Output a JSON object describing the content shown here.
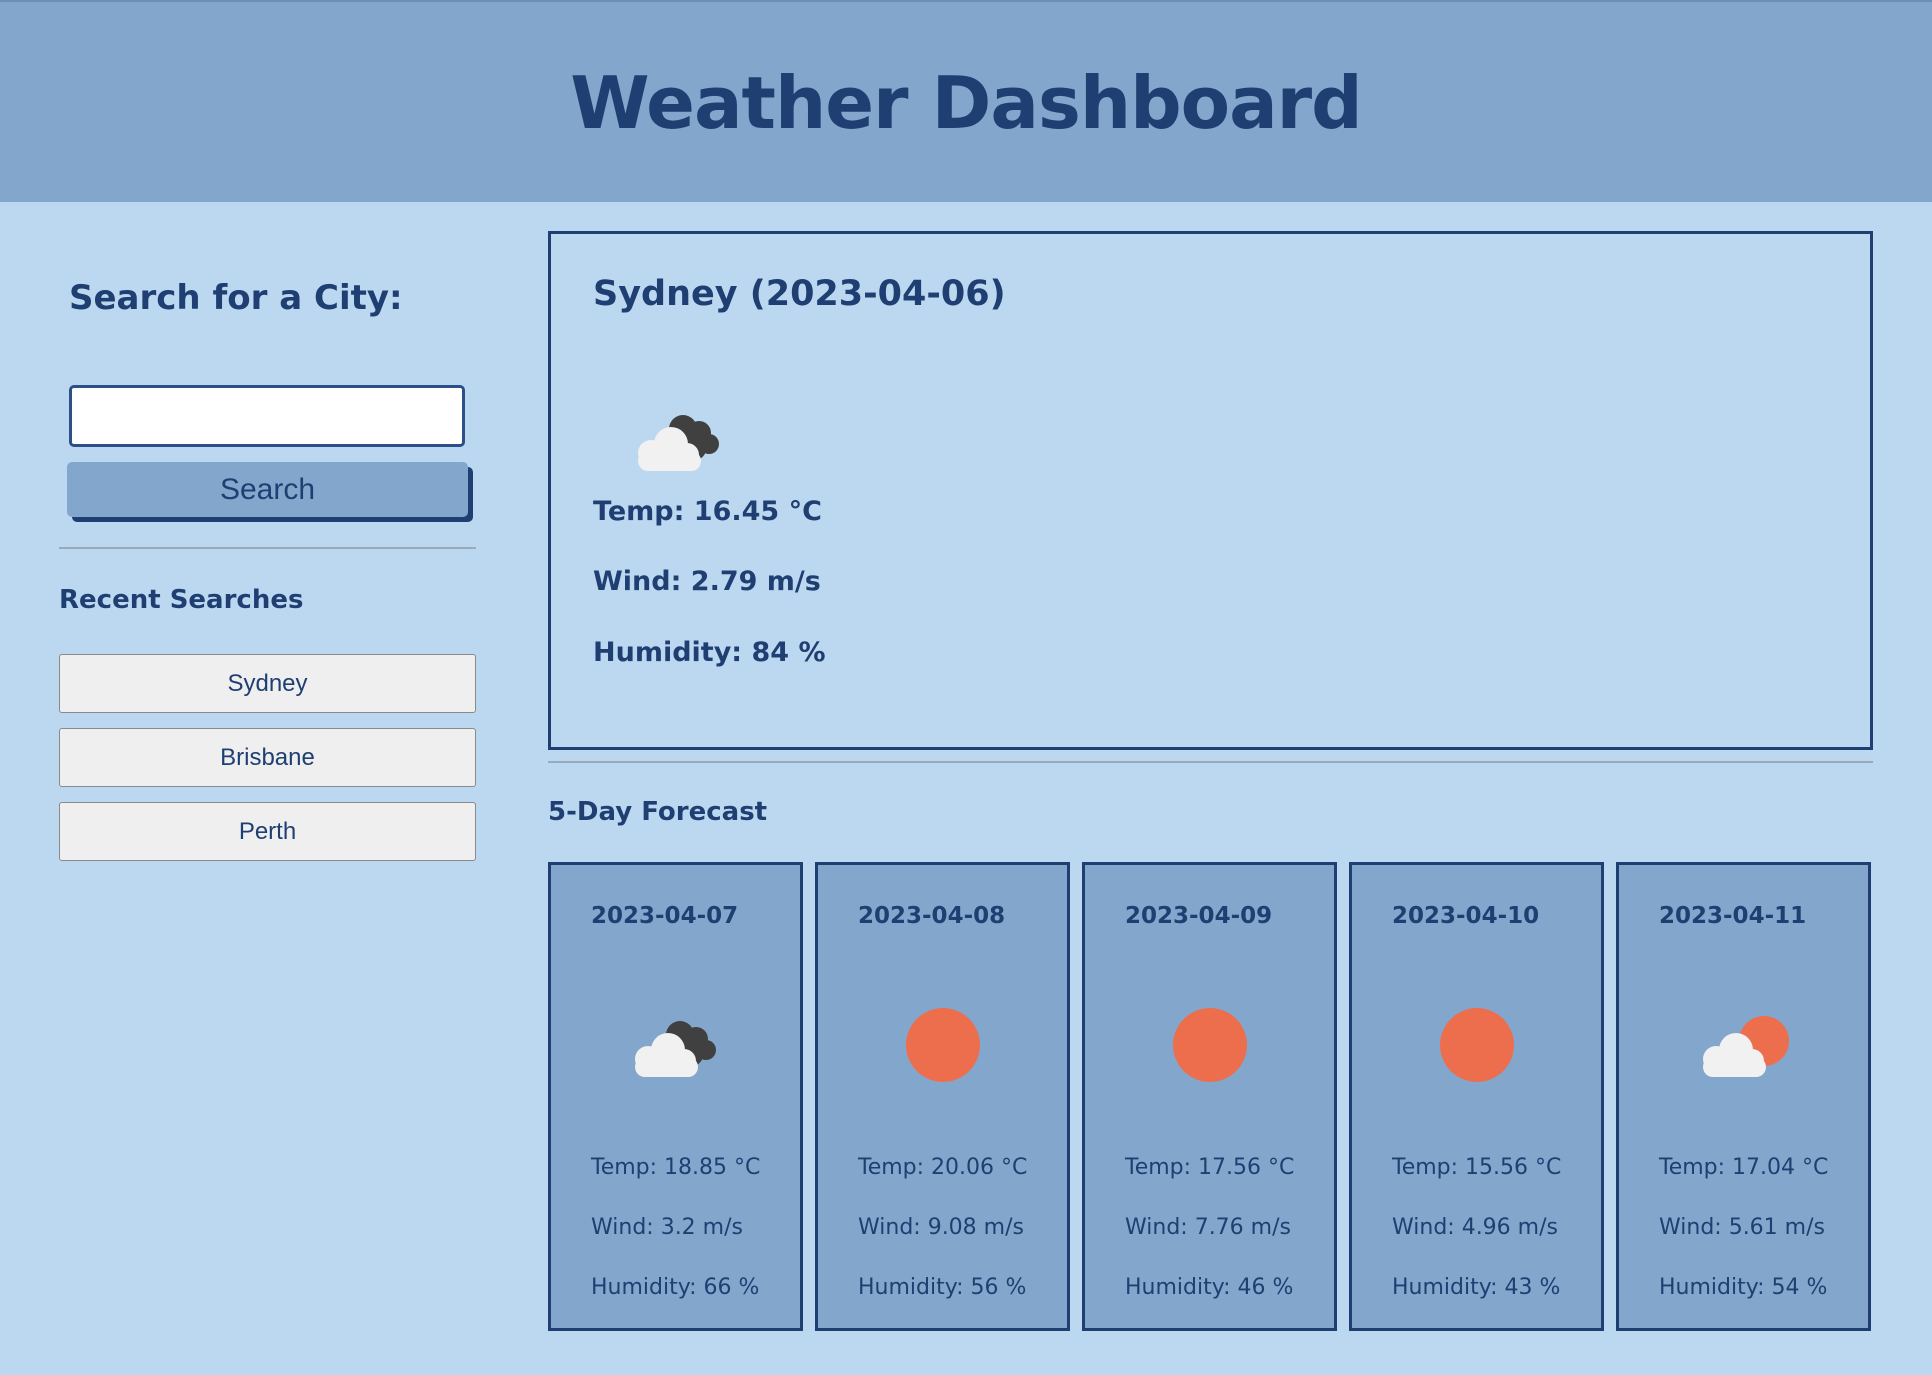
{
  "header": {
    "title": "Weather Dashboard"
  },
  "sidebar": {
    "search_title": "Search for a City:",
    "search_input": {
      "value": "",
      "placeholder": ""
    },
    "search_button_label": "Search",
    "recent_title": "Recent Searches",
    "recent_items": [
      {
        "label": "Sydney"
      },
      {
        "label": "Brisbane"
      },
      {
        "label": "Perth"
      }
    ]
  },
  "current": {
    "title": "Sydney (2023-04-06)",
    "icon": "cloudy-icon",
    "temp": "Temp: 16.45 °C",
    "wind": "Wind: 2.79 m/s",
    "humidity": "Humidity: 84 %"
  },
  "forecast": {
    "title": "5-Day Forecast",
    "days": [
      {
        "date": "2023-04-07",
        "icon": "cloudy-icon",
        "temp": "Temp: 18.85 °C",
        "wind": "Wind: 3.2 m/s",
        "humidity": "Humidity: 66 %"
      },
      {
        "date": "2023-04-08",
        "icon": "sun-icon",
        "temp": "Temp: 20.06 °C",
        "wind": "Wind: 9.08 m/s",
        "humidity": "Humidity: 56 %"
      },
      {
        "date": "2023-04-09",
        "icon": "sun-icon",
        "temp": "Temp: 17.56 °C",
        "wind": "Wind: 7.76 m/s",
        "humidity": "Humidity: 46 %"
      },
      {
        "date": "2023-04-10",
        "icon": "sun-icon",
        "temp": "Temp: 15.56 °C",
        "wind": "Wind: 4.96 m/s",
        "humidity": "Humidity: 43 %"
      },
      {
        "date": "2023-04-11",
        "icon": "partly-cloudy-icon",
        "temp": "Temp: 17.04 °C",
        "wind": "Wind: 5.61 m/s",
        "humidity": "Humidity: 54 %"
      }
    ]
  },
  "colors": {
    "page_background": "#bcd8f0",
    "header_background": "#83a7cc",
    "text": "#1f3f73",
    "sun": "#ec6e4c",
    "cloud_light": "#f1f1f1",
    "cloud_dark": "#404040"
  }
}
